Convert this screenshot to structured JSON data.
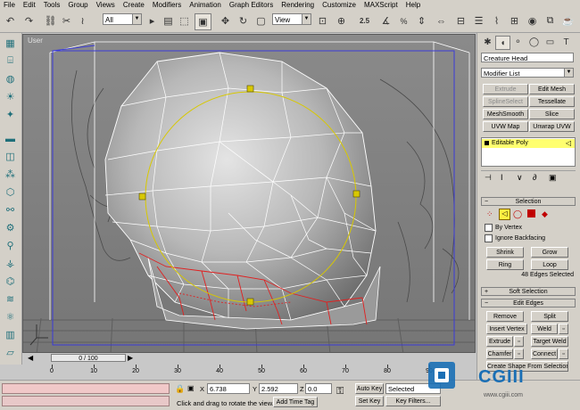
{
  "menu": [
    "File",
    "Edit",
    "Tools",
    "Group",
    "Views",
    "Create",
    "Modifiers",
    "Animation",
    "Graph Editors",
    "Rendering",
    "Customize",
    "MAXScript",
    "Help"
  ],
  "toolbar": {
    "selection_filter": "All",
    "coord_system": "View",
    "angle_snap_value": "2.5"
  },
  "viewport": {
    "label": "User"
  },
  "command_panel": {
    "object_name": "Creature Head",
    "modifier_list": "Modifier List",
    "modifier_buttons": [
      "Extrude",
      "Edit Mesh",
      "SplineSelect",
      "Tessellate",
      "MeshSmooth",
      "Slice",
      "UVW Map",
      "Unwrap UVW"
    ],
    "stack_item": "Editable Poly",
    "selection_rollout": "Selection",
    "by_vertex": "By Vertex",
    "ignore_backfacing": "Ignore Backfacing",
    "shrink": "Shrink",
    "grow": "Grow",
    "ring": "Ring",
    "loop": "Loop",
    "selection_status": "48 Edges Selected",
    "soft_selection": "Soft Selection",
    "edit_edges": "Edit Edges",
    "edge_buttons": [
      "Remove",
      "Split",
      "Insert Vertex",
      "Weld",
      "Extrude",
      "Target Weld",
      "Chamfer",
      "Connect"
    ],
    "create_shape": "Create Shape From Selection"
  },
  "timeline": {
    "slider": "0 / 100",
    "ticks": [
      "0",
      "10",
      "20",
      "30",
      "40",
      "50",
      "60",
      "70",
      "80",
      "90"
    ]
  },
  "status": {
    "prompt": "Click and drag to rotate the view.",
    "x_label": "X",
    "x_value": "6.738",
    "y_label": "Y",
    "y_value": "2.592",
    "z_label": "Z",
    "z_value": "0.0",
    "add_time_tag": "Add Time Tag",
    "auto_key": "Auto Key",
    "set_key": "Set Key",
    "key_mode": "Selected",
    "key_filters": "Key Filters..."
  },
  "watermark": {
    "brand": "CGIII",
    "url": "www.cgiii.com"
  },
  "colors": {
    "wire_white": "#ffffff",
    "wire_red": "#e02020",
    "gizmo_yellow": "#d8c800",
    "bbox_blue": "#3a3ad8",
    "stack_highlight": "#ffff70"
  }
}
